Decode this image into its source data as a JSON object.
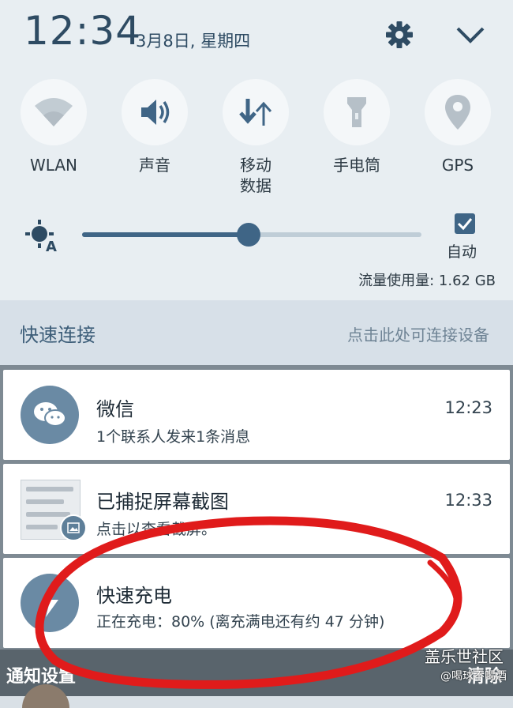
{
  "status": {
    "time": "12:34",
    "date": "3月8日, 星期四"
  },
  "tiles": [
    {
      "label": "WLAN",
      "icon": "wifi-icon"
    },
    {
      "label": "声音",
      "icon": "speaker-icon"
    },
    {
      "label": "移动\n数据",
      "icon": "mobile-data-icon"
    },
    {
      "label": "手电筒",
      "icon": "flashlight-icon"
    },
    {
      "label": "GPS",
      "icon": "location-pin-icon"
    }
  ],
  "brightness": {
    "level": 0.49,
    "auto_label": "自动",
    "auto_checked": true
  },
  "data_usage": "流量使用量: 1.62 GB",
  "quick_connect": {
    "title": "快速连接",
    "link": "点击此处可连接设备"
  },
  "notifications": [
    {
      "app": "wechat",
      "title": "微信",
      "body": "1个联系人发来1条消息",
      "time": "12:23"
    },
    {
      "app": "screenshot",
      "title": "已捕捉屏幕截图",
      "body": "点击以查看截屏。",
      "time": "12:33"
    },
    {
      "app": "fast-charge",
      "title": "快速充电",
      "body": "正在充电：80% (离充满电还有约 47 分钟)",
      "time": ""
    }
  ],
  "bottom": {
    "settings_label": "通知设置",
    "clear_label": "清除"
  },
  "watermark": {
    "line1": "盖乐世社区",
    "line2": "@喝球不喝酒"
  },
  "colors": {
    "accent": "#3f6586",
    "panel": "#e8eef2",
    "annotation": "#e01b1b"
  }
}
